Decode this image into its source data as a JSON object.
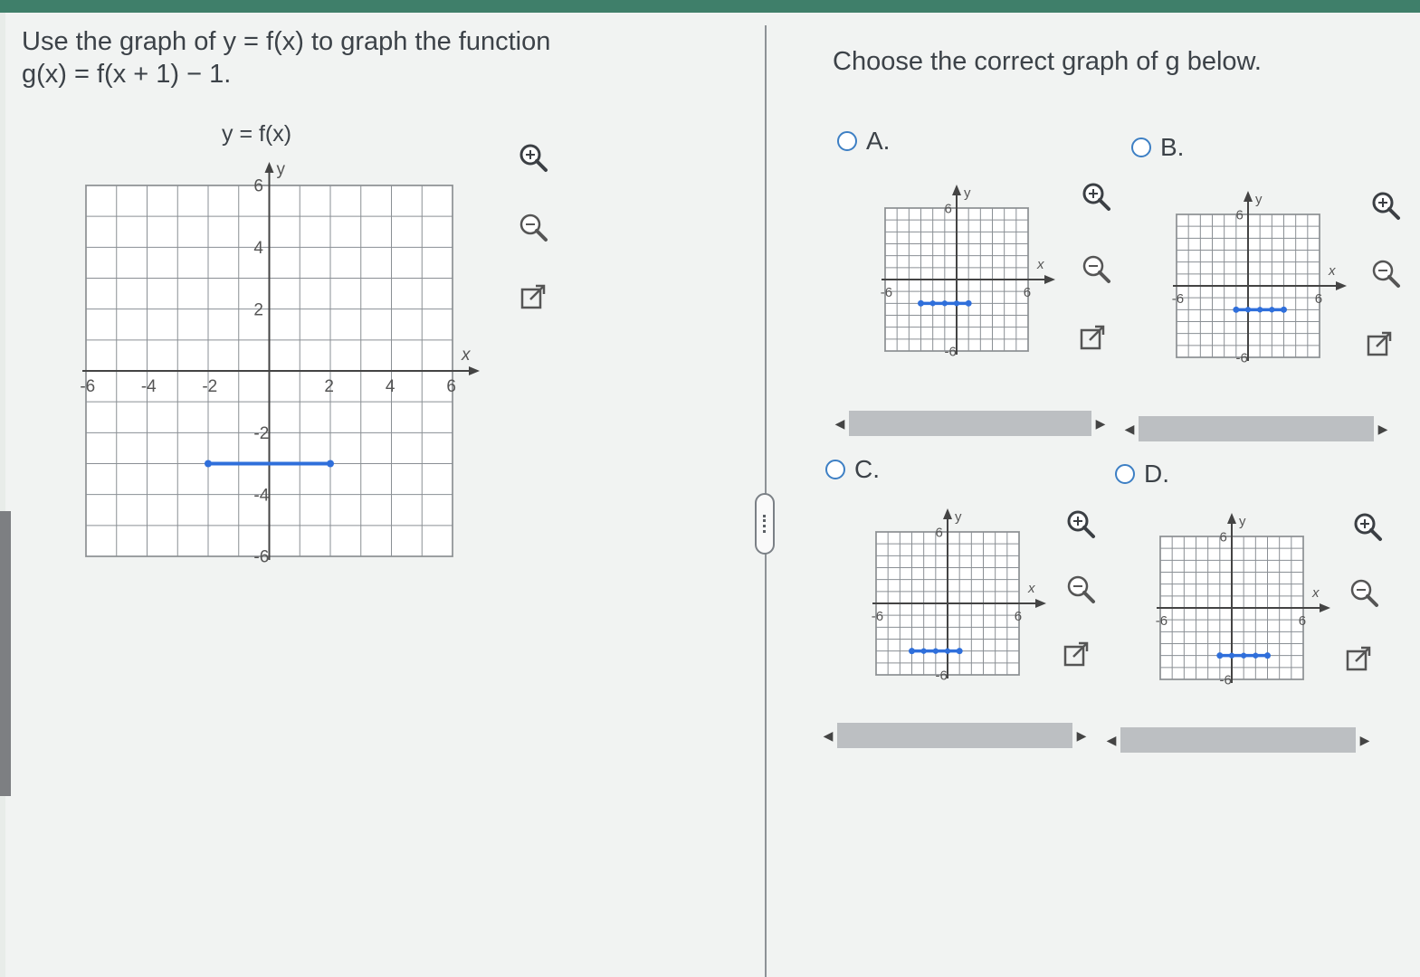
{
  "question": {
    "line1": "Use the graph of y = f(x) to graph the function",
    "line2": "g(x) = f(x + 1) − 1."
  },
  "prompt": "Choose the correct graph of g below.",
  "main_graph": {
    "title": "y = f(x)",
    "x_label": "x",
    "y_label": "y",
    "x_ticks": [
      "-6",
      "-4",
      "-2",
      "2",
      "4",
      "6"
    ],
    "y_ticks": [
      "6",
      "4",
      "2",
      "-2",
      "-4",
      "-6"
    ],
    "segment": {
      "x_start": -2,
      "x_end": 2,
      "y": -3
    }
  },
  "options": [
    {
      "letter": "A.",
      "x_label": "x",
      "y_label": "y",
      "tick_pos": "6",
      "tick_neg": "-6",
      "segment": {
        "x_start": -3,
        "x_end": 1,
        "y": -2
      }
    },
    {
      "letter": "B.",
      "x_label": "x",
      "y_label": "y",
      "tick_pos": "6",
      "tick_neg": "-6",
      "segment": {
        "x_start": -1,
        "x_end": 3,
        "y": -2
      }
    },
    {
      "letter": "C.",
      "x_label": "x",
      "y_label": "y",
      "tick_pos": "6",
      "tick_neg": "-6",
      "segment": {
        "x_start": -3,
        "x_end": 1,
        "y": -4
      }
    },
    {
      "letter": "D.",
      "x_label": "x",
      "y_label": "y",
      "tick_pos": "6",
      "tick_neg": "-6",
      "segment": {
        "x_start": -1,
        "x_end": 3,
        "y": -4
      }
    }
  ],
  "tools": {
    "zoom_in": "zoom-in-icon",
    "zoom_out": "zoom-out-icon",
    "popout": "popout-icon"
  },
  "colors": {
    "segment": "#2f6fdb",
    "radio": "#3d7fc4",
    "header": "#3f7f6a"
  }
}
